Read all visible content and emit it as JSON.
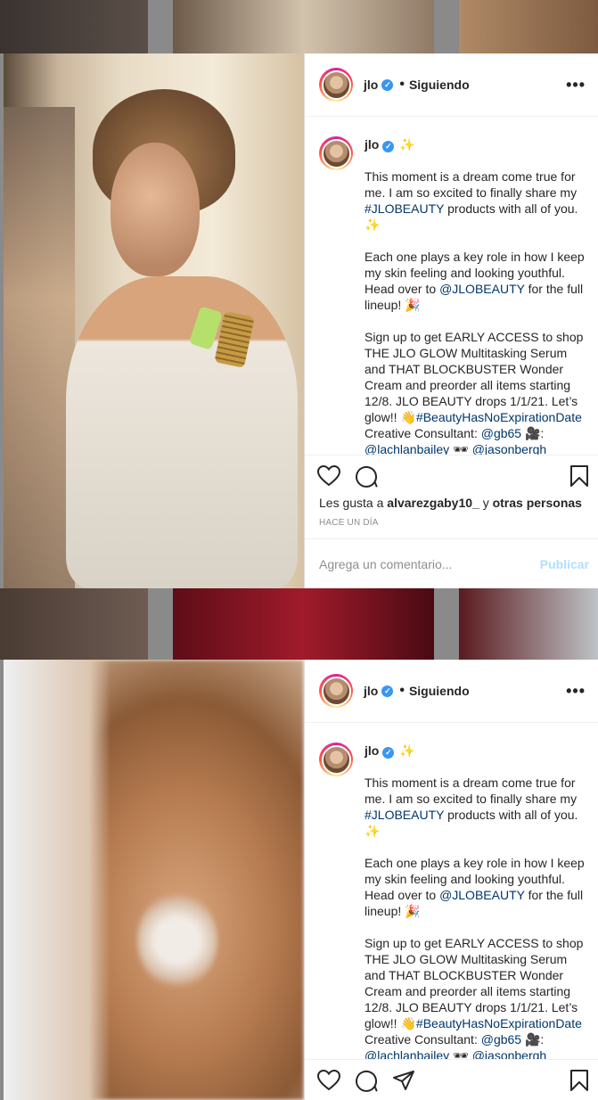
{
  "colors": {
    "accent_link": "#00376b",
    "verified": "#3897f0",
    "publish_disabled": "#b2dffc",
    "muted_text": "#8e8e8e"
  },
  "posts": [
    {
      "header": {
        "username": "jlo",
        "dot": "•",
        "follow_status": "Siguiendo",
        "more": "•••"
      },
      "caption": {
        "username": "jlo",
        "emoji": "✨",
        "p1_text": "This moment is a dream come true for me. I am so excited to finally share my ",
        "p1_hashtag": "#JLOBEAUTY",
        "p1_tail": " products with all of you. ✨",
        "p2_text": "Each one plays a key role in how I keep my skin feeling and looking youthful. Head over to ",
        "p2_mention": "@JLOBEAUTY",
        "p2_tail": " for the full lineup! 🎉",
        "p3_text": "Sign up to get EARLY ACCESS to shop THE JLO GLOW Multitasking Serum and THAT BLOCKBUSTER Wonder Cream and preorder all items starting 12/8. JLO BEAUTY drops 1/1/21. Let’s glow!! 👋",
        "p3_hashtag": "#BeautyHasNoExpirationDate",
        "p4_text": "Creative Consultant: ",
        "p4_mention": "@gb65",
        "p4_tail": " 🎥:",
        "p5_mention1": "@lachlanbailey",
        "p5_mid": " 🕶 ",
        "p5_mention2": "@jasonbergh"
      },
      "likes": {
        "prefix": "Les gusta a ",
        "user": "alvarezgaby10_",
        "mid": " y ",
        "others": "otras personas"
      },
      "timestamp": "HACE UN DÍA",
      "comment": {
        "placeholder": "Agrega un comentario...",
        "publish": "Publicar"
      }
    },
    {
      "header": {
        "username": "jlo",
        "dot": "•",
        "follow_status": "Siguiendo",
        "more": "•••"
      },
      "caption": {
        "username": "jlo",
        "emoji": "✨",
        "p1_text": "This moment is a dream come true for me. I am so excited to finally share my ",
        "p1_hashtag": "#JLOBEAUTY",
        "p1_tail": " products with all of you. ✨",
        "p2_text": "Each one plays a key role in how I keep my skin feeling and looking youthful. Head over to ",
        "p2_mention": "@JLOBEAUTY",
        "p2_tail": " for the full lineup! 🎉",
        "p3_text": "Sign up to get EARLY ACCESS to shop THE JLO GLOW Multitasking Serum and THAT BLOCKBUSTER Wonder Cream and preorder all items starting 12/8. JLO BEAUTY drops 1/1/21. Let’s glow!! 👋",
        "p3_hashtag": "#BeautyHasNoExpirationDate",
        "p4_text": "Creative Consultant: ",
        "p4_mention": "@gb65",
        "p4_tail": " 🎥:",
        "p5_mention1": "@lachlanbailey",
        "p5_mid": " 🕶 ",
        "p5_mention2": "@jasonbergh"
      }
    }
  ]
}
